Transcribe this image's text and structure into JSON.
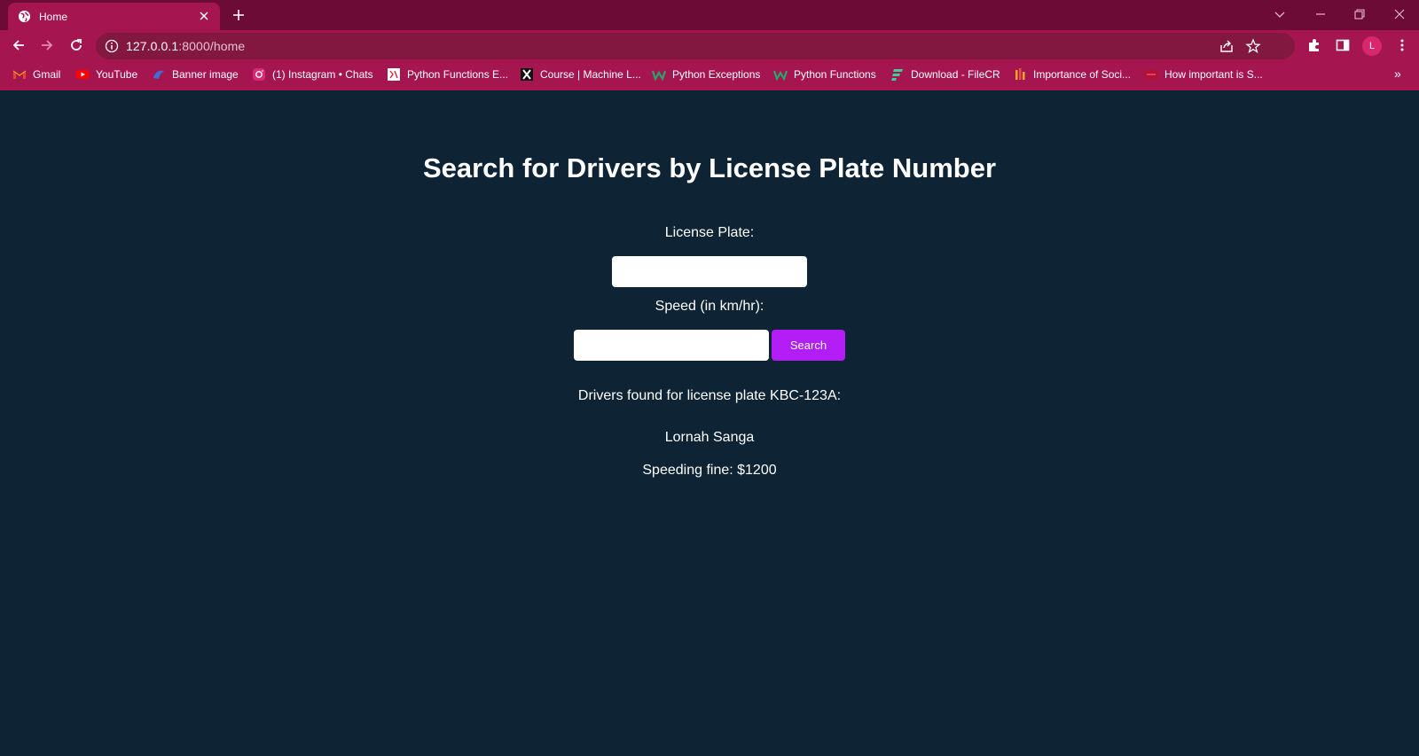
{
  "browser": {
    "tab_title": "Home",
    "url_host": "127.0.0.1",
    "url_path": ":8000/home",
    "avatar_letter": "L",
    "bookmarks": [
      {
        "label": "Gmail",
        "icon": "gmail-icon"
      },
      {
        "label": "YouTube",
        "icon": "youtube-icon"
      },
      {
        "label": "Banner image",
        "icon": "banner-icon"
      },
      {
        "label": "(1) Instagram • Chats",
        "icon": "instagram-icon"
      },
      {
        "label": "Python Functions E...",
        "icon": "python-doc-icon"
      },
      {
        "label": "Course | Machine L...",
        "icon": "x-icon"
      },
      {
        "label": "Python Exceptions",
        "icon": "w-icon"
      },
      {
        "label": "Python Functions",
        "icon": "w-icon"
      },
      {
        "label": "Download - FileCR",
        "icon": "filecr-icon"
      },
      {
        "label": "Importance of Soci...",
        "icon": "bars-icon"
      },
      {
        "label": "How important is S...",
        "icon": "red-box-icon"
      }
    ],
    "more_bookmarks": "»"
  },
  "page": {
    "heading": "Search for Drivers by License Plate Number",
    "plate_label": "License Plate:",
    "plate_value": "",
    "speed_label": "Speed (in km/hr):",
    "speed_value": "",
    "search_label": "Search",
    "results_title": "Drivers found for license plate KBC-123A:",
    "driver_name": "Lornah Sanga",
    "fine_text": "Speeding fine: $1200"
  },
  "colors": {
    "page_bg": "#0e2333",
    "chrome": "#a51651",
    "tabstrip": "#6b0b36",
    "button": "#b21ef5"
  }
}
